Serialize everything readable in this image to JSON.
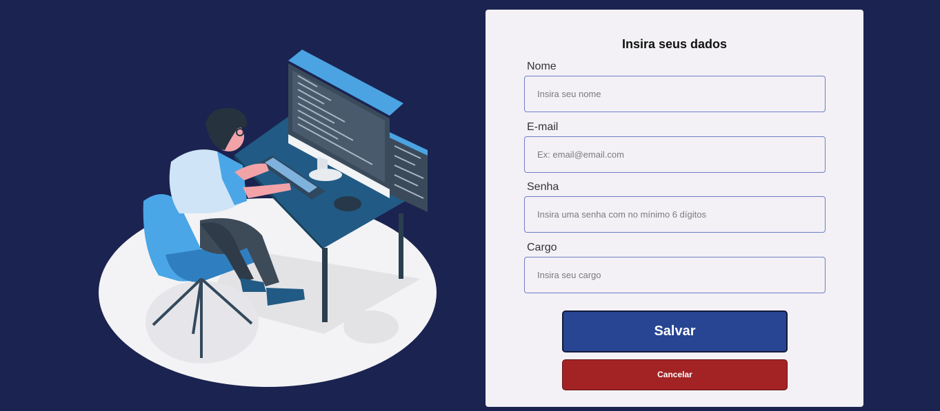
{
  "form": {
    "title": "Insira seus dados",
    "fields": [
      {
        "label": "Nome",
        "placeholder": "Insira seu nome",
        "value": ""
      },
      {
        "label": "E-mail",
        "placeholder": "Ex: email@email.com",
        "value": ""
      },
      {
        "label": "Senha",
        "placeholder": "Insira uma senha com no mínimo 6 dígitos",
        "value": ""
      },
      {
        "label": "Cargo",
        "placeholder": "Insira seu cargo",
        "value": ""
      }
    ],
    "save_label": "Salvar",
    "cancel_label": "Cancelar"
  },
  "colors": {
    "background": "#1b2350",
    "card": "#f3f1f6",
    "input_border": "#6f7cc4",
    "save_button": "#274592",
    "cancel_button": "#a32324"
  }
}
